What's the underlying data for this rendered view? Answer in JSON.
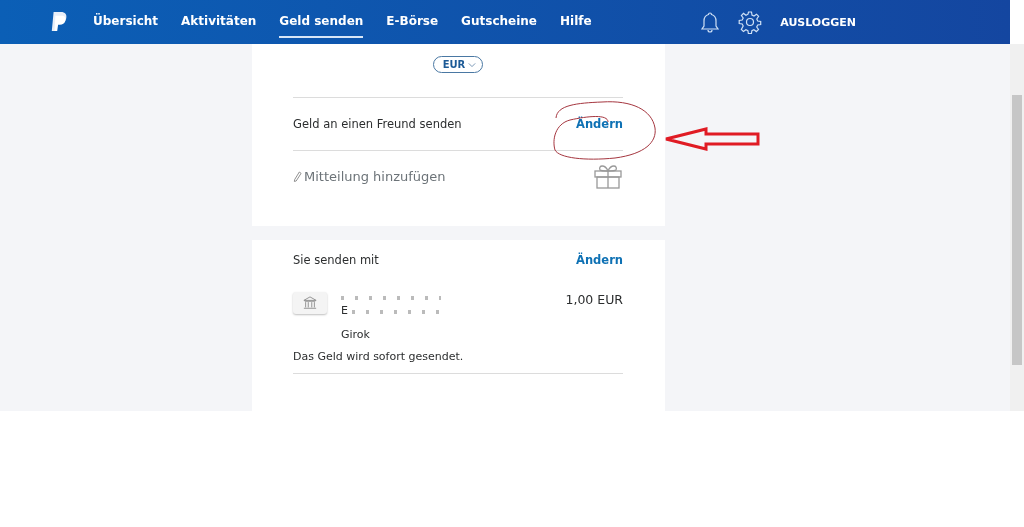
{
  "nav": {
    "items": [
      {
        "label": "Übersicht",
        "selected": false
      },
      {
        "label": "Aktivitäten",
        "selected": false
      },
      {
        "label": "Geld senden",
        "selected": true
      },
      {
        "label": "E-Börse",
        "selected": false
      },
      {
        "label": "Gutscheine",
        "selected": false
      },
      {
        "label": "Hilfe",
        "selected": false
      }
    ],
    "logout": "AUSLOGGEN"
  },
  "recipient_card": {
    "currency": "EUR",
    "recipient_label": "Geld an einen Freund senden",
    "change_link": "Ändern",
    "message_placeholder": "Mitteilung hinzufügen"
  },
  "funding_card": {
    "title": "Sie senden mit",
    "change_link": "Ändern",
    "bank_lines": [
      "E",
      "Girok"
    ],
    "amount": "1,00 EUR",
    "note": "Das Geld wird sofort gesendet."
  }
}
